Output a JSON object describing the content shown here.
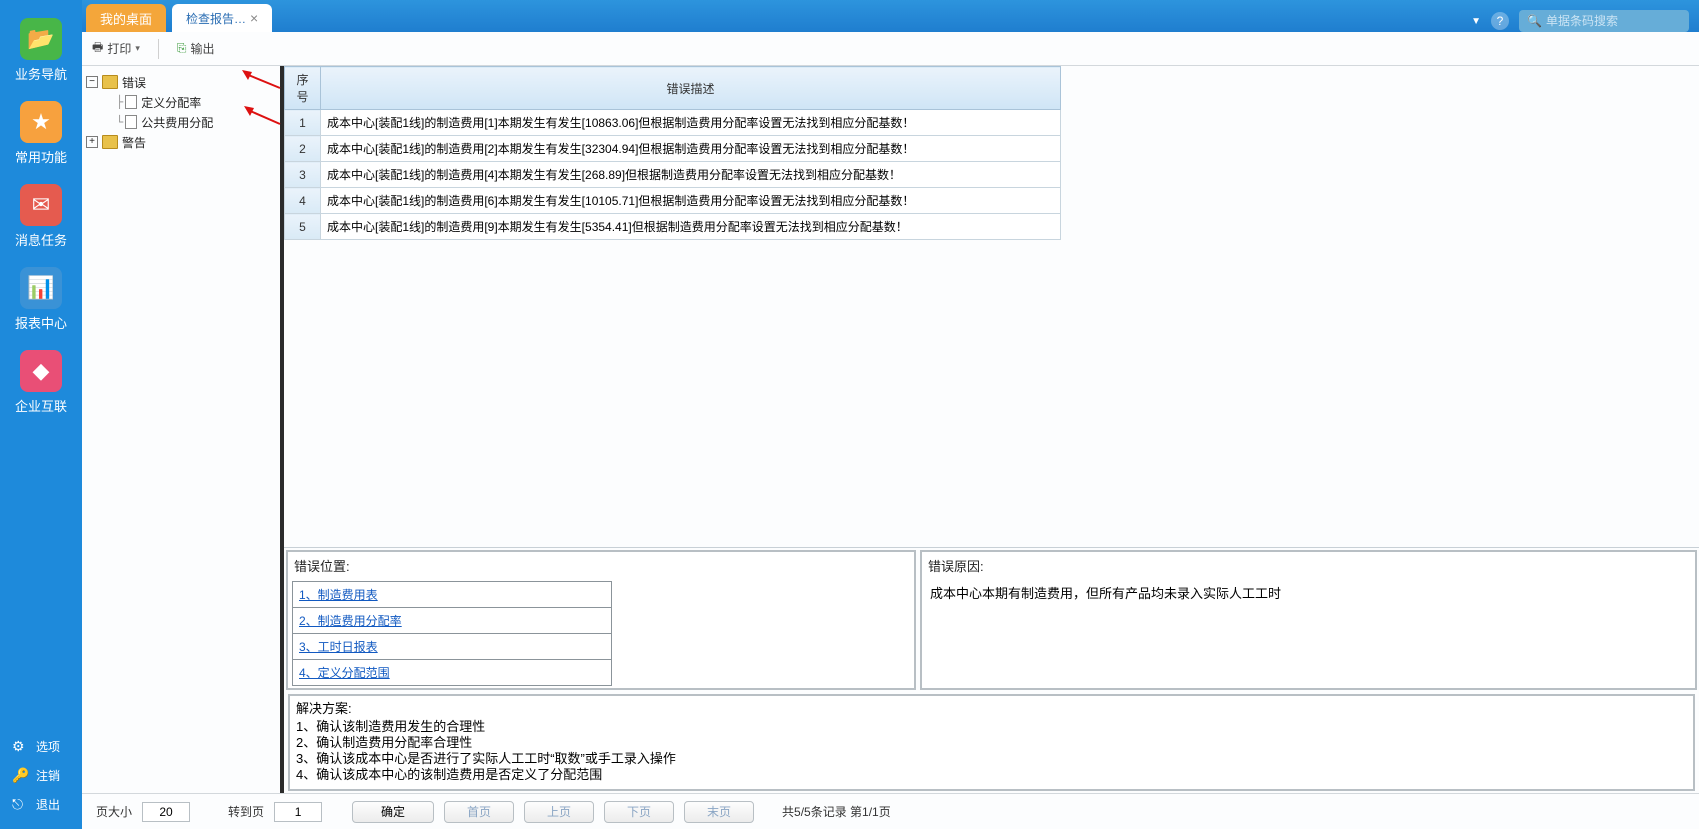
{
  "sidebar": {
    "items": [
      {
        "label": "业务导航",
        "icon": "📂",
        "cls": "green"
      },
      {
        "label": "常用功能",
        "icon": "★",
        "cls": "orange"
      },
      {
        "label": "消息任务",
        "icon": "✉",
        "cls": "red"
      },
      {
        "label": "报表中心",
        "icon": "📊",
        "cls": "blue"
      },
      {
        "label": "企业互联",
        "icon": "◆",
        "cls": "pink"
      }
    ],
    "bottom": [
      {
        "label": "选项",
        "icon": "⚙"
      },
      {
        "label": "注销",
        "icon": "🔑"
      },
      {
        "label": "退出",
        "icon": "⎋"
      }
    ]
  },
  "tabs": {
    "desktop": "我的桌面",
    "active": "检查报告…"
  },
  "search": {
    "placeholder": "单据条码搜索"
  },
  "toolbar": {
    "print": "打印",
    "export": "输出"
  },
  "tree": {
    "errors": {
      "label": "错误",
      "children": [
        "定义分配率",
        "公共费用分配"
      ]
    },
    "warnings": {
      "label": "警告"
    }
  },
  "table": {
    "headers": {
      "seq": "序号",
      "desc": "错误描述"
    },
    "rows": [
      {
        "seq": "1",
        "desc": "成本中心[装配1线]的制造费用[1]本期发生有发生[10863.06]但根据制造费用分配率设置无法找到相应分配基数！"
      },
      {
        "seq": "2",
        "desc": "成本中心[装配1线]的制造费用[2]本期发生有发生[32304.94]但根据制造费用分配率设置无法找到相应分配基数！"
      },
      {
        "seq": "3",
        "desc": "成本中心[装配1线]的制造费用[4]本期发生有发生[268.89]但根据制造费用分配率设置无法找到相应分配基数！"
      },
      {
        "seq": "4",
        "desc": "成本中心[装配1线]的制造费用[6]本期发生有发生[10105.71]但根据制造费用分配率设置无法找到相应分配基数！"
      },
      {
        "seq": "5",
        "desc": "成本中心[装配1线]的制造费用[9]本期发生有发生[5354.41]但根据制造费用分配率设置无法找到相应分配基数！"
      }
    ]
  },
  "location": {
    "title": "错误位置:",
    "links": [
      "1、制造费用表",
      "2、制造费用分配率",
      "3、工时日报表",
      "4、定义分配范围"
    ]
  },
  "reason": {
    "title": "错误原因:",
    "body": "成本中心本期有制造费用，但所有产品均未录入实际人工工时"
  },
  "solution": {
    "title": "解决方案:",
    "lines": [
      "1、确认该制造费用发生的合理性",
      "2、确认制造费用分配率合理性",
      "3、确认该成本中心是否进行了实际人工工时“取数”或手工录入操作",
      "4、确认该成本中心的该制造费用是否定义了分配范围"
    ]
  },
  "pager": {
    "page_size_label": "页大小",
    "page_size": "20",
    "goto_label": "转到页",
    "goto": "1",
    "confirm": "确定",
    "first": "首页",
    "prev": "上页",
    "next": "下页",
    "last": "末页",
    "summary": "共5/5条记录 第1/1页"
  }
}
